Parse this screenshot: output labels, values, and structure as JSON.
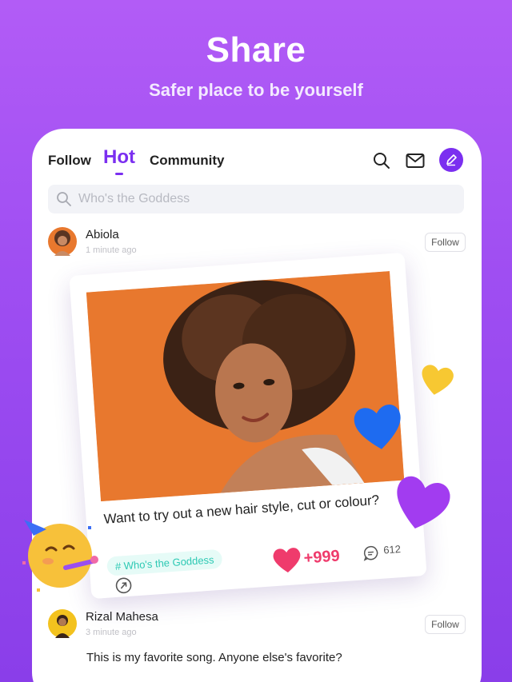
{
  "hero": {
    "title": "Share",
    "subtitle": "Safer place to be yourself"
  },
  "nav": {
    "tabs": [
      {
        "label": "Follow"
      },
      {
        "label": "Hot",
        "active": true
      },
      {
        "label": "Community"
      }
    ],
    "icons": [
      "search-icon",
      "mail-icon",
      "pencil-icon"
    ]
  },
  "search": {
    "placeholder": "Who's the Goddess"
  },
  "posts": [
    {
      "author": "Abiola",
      "time": "1 minute ago",
      "follow_label": "Follow"
    },
    {
      "author": "Rizal Mahesa",
      "time": "3 minute ago",
      "follow_label": "Follow",
      "text": "This is my favorite song. Anyone else's favorite?"
    }
  ],
  "card": {
    "text": "Want to try out a new hair style, cut or colour?",
    "tag": "# Who's the Goddess",
    "likes": "+999",
    "comments": "612"
  },
  "colors": {
    "accent": "#7b2ff0",
    "like": "#ef3b6c",
    "tag": "#2ec9b4",
    "background": "#9f4ef2"
  }
}
